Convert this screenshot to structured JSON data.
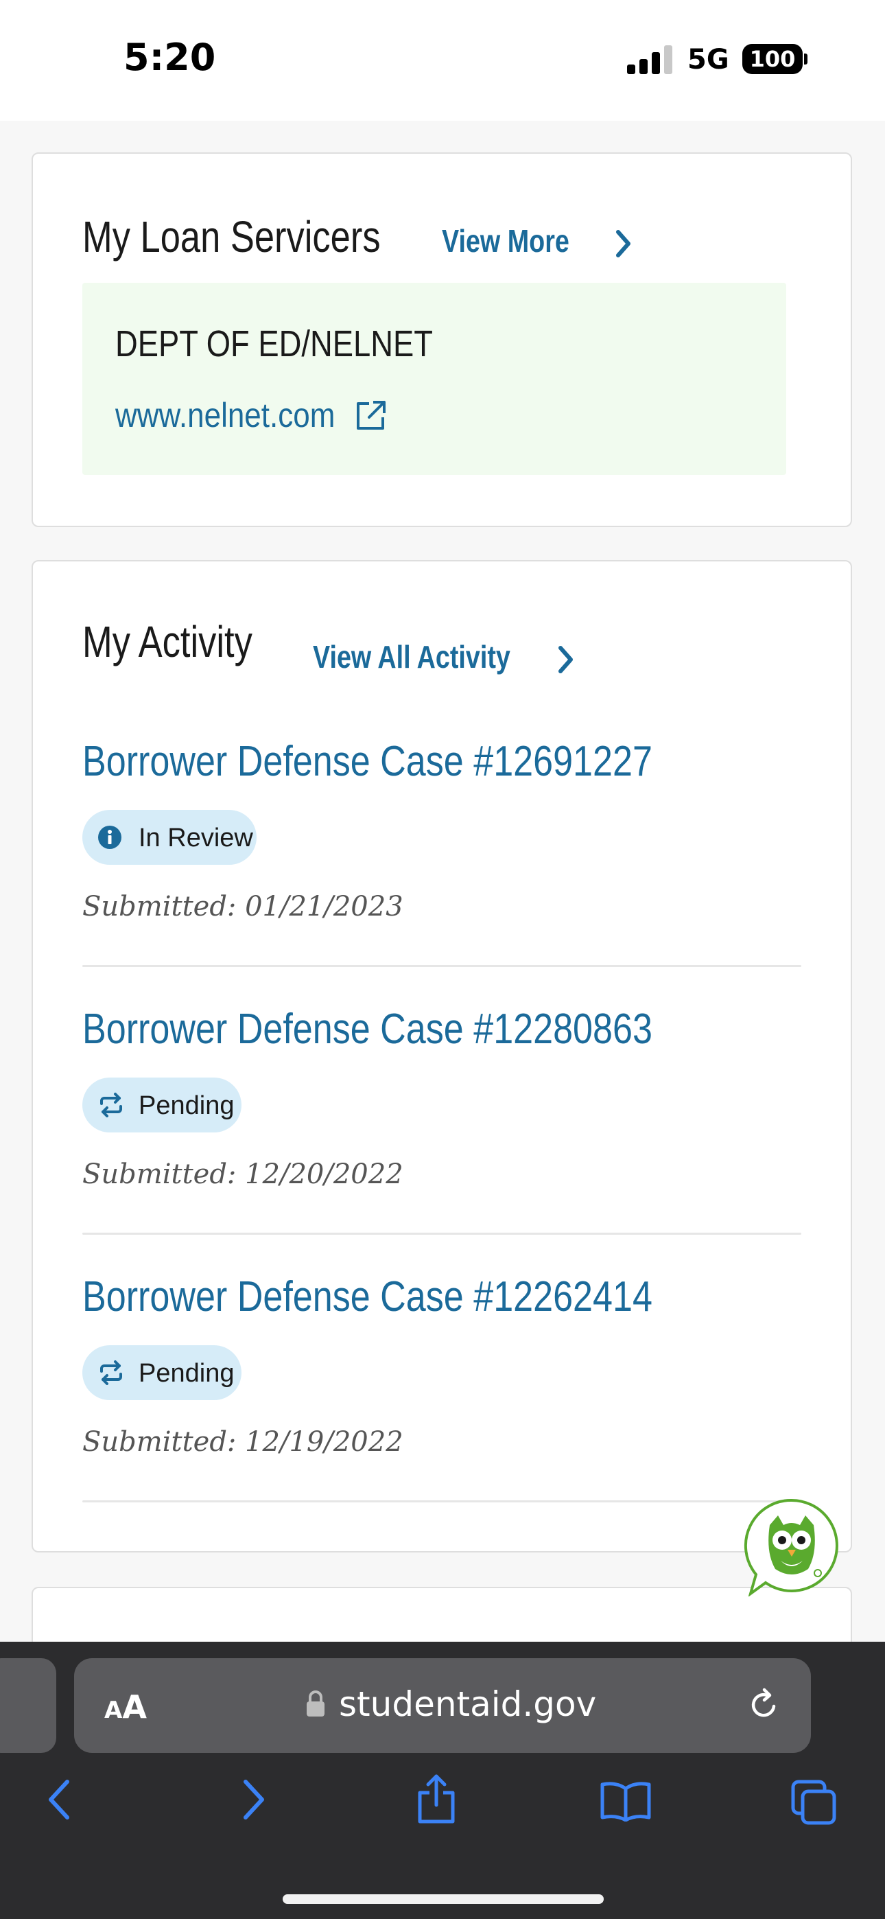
{
  "status_bar": {
    "time": "5:20",
    "network": "5G",
    "battery": "100"
  },
  "loan_servicers": {
    "title": "My Loan Servicers",
    "view_more": "View More",
    "servicer_name": "DEPT OF ED/NELNET",
    "servicer_url": "www.nelnet.com"
  },
  "activity": {
    "title": "My Activity",
    "view_all": "View All Activity",
    "items": [
      {
        "title": "Borrower Defense Case #12691227",
        "status": "In Review",
        "status_icon": "info-icon",
        "submitted": "Submitted: 01/21/2023"
      },
      {
        "title": "Borrower Defense Case #12280863",
        "status": "Pending",
        "status_icon": "sync-icon",
        "submitted": "Submitted: 12/20/2022"
      },
      {
        "title": "Borrower Defense Case #12262414",
        "status": "Pending",
        "status_icon": "sync-icon",
        "submitted": "Submitted: 12/19/2022"
      }
    ]
  },
  "browser": {
    "text_size_label_small": "A",
    "text_size_label_big": "A",
    "url": "studentaid.gov"
  },
  "colors": {
    "link": "#1b6a9a",
    "badge_bg": "#d6ecf8",
    "servicer_bg": "#f1fbef",
    "browser_bg": "#2c2c2e",
    "ios_blue": "#3b82f6",
    "owl_green": "#5aaa2e"
  }
}
